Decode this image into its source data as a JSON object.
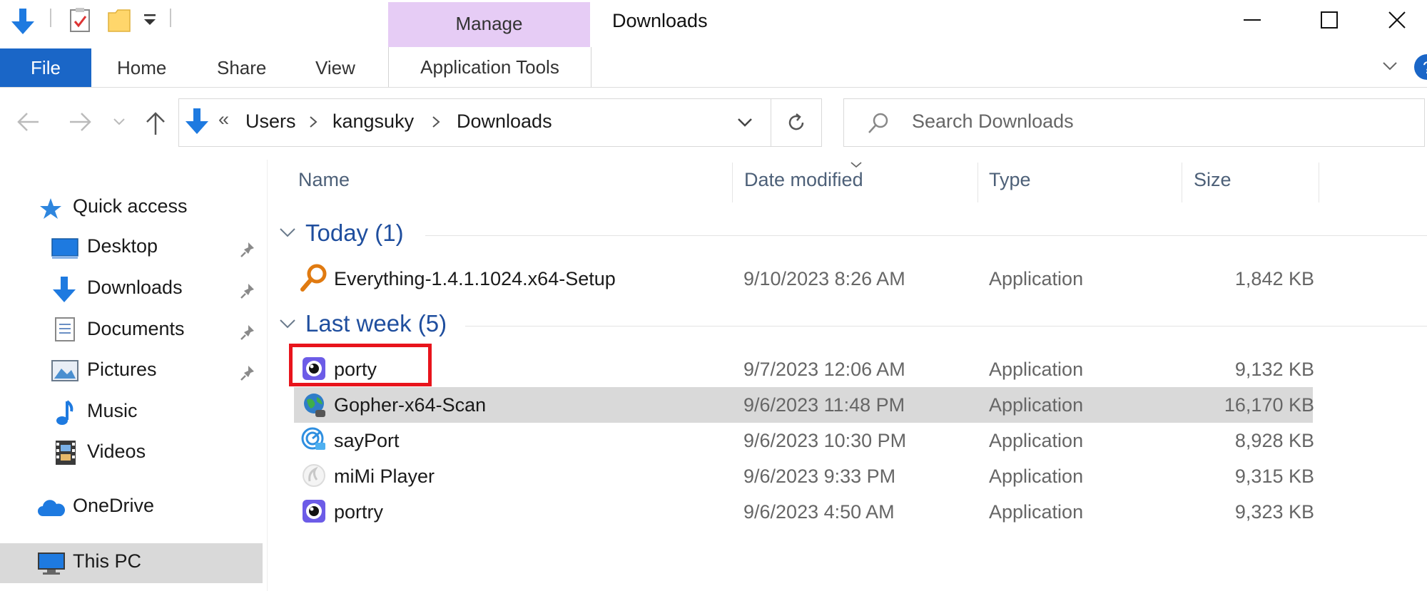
{
  "window": {
    "title": "Downloads",
    "manage_tab": "Manage"
  },
  "ribbon": {
    "file": "File",
    "home": "Home",
    "share": "Share",
    "view": "View",
    "application_tools": "Application Tools"
  },
  "address": {
    "overflow": "«",
    "crumbs": [
      "Users",
      "kangsuky",
      "Downloads"
    ],
    "search_placeholder": "Search Downloads"
  },
  "nav": {
    "quick_access": "Quick access",
    "desktop": "Desktop",
    "downloads": "Downloads",
    "documents": "Documents",
    "pictures": "Pictures",
    "music": "Music",
    "videos": "Videos",
    "onedrive": "OneDrive",
    "this_pc": "This PC"
  },
  "columns": {
    "name": "Name",
    "date_modified": "Date modified",
    "type": "Type",
    "size": "Size"
  },
  "groups": [
    {
      "label": "Today (1)",
      "files": [
        {
          "name": "Everything-1.4.1.1024.x64-Setup",
          "date": "9/10/2023 8:26 AM",
          "type": "Application",
          "size": "1,842 KB",
          "icon": "magnifier-app-icon"
        }
      ]
    },
    {
      "label": "Last week (5)",
      "files": [
        {
          "name": "porty",
          "date": "9/7/2023 12:06 AM",
          "type": "Application",
          "size": "9,132 KB",
          "icon": "eye-app-icon"
        },
        {
          "name": "Gopher-x64-Scan",
          "date": "9/6/2023 11:48 PM",
          "type": "Application",
          "size": "16,170 KB",
          "icon": "globe-app-icon"
        },
        {
          "name": "sayPort",
          "date": "9/6/2023 10:30 PM",
          "type": "Application",
          "size": "8,928 KB",
          "icon": "radar-app-icon"
        },
        {
          "name": "miMi Player",
          "date": "9/6/2023 9:33 PM",
          "type": "Application",
          "size": "9,315 KB",
          "icon": "player-app-icon"
        },
        {
          "name": "portry",
          "date": "9/6/2023 4:50 AM",
          "type": "Application",
          "size": "9,323 KB",
          "icon": "eye-app-icon"
        }
      ]
    }
  ],
  "colors": {
    "accent": "#1a66c7",
    "manage_tab": "#e6ccf5",
    "highlight_box": "#e8141c",
    "selected_row": "#d9d9d9",
    "group_header": "#1f4e9e"
  }
}
